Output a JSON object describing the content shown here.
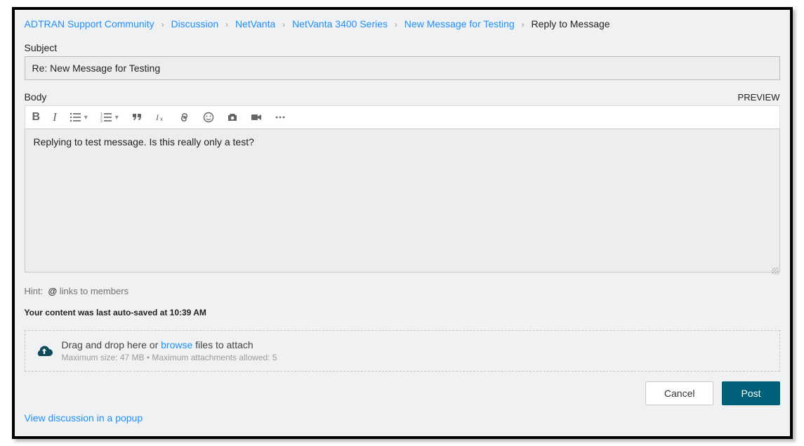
{
  "breadcrumb": {
    "items": [
      {
        "label": "ADTRAN Support Community"
      },
      {
        "label": "Discussion"
      },
      {
        "label": "NetVanta"
      },
      {
        "label": "NetVanta 3400 Series"
      },
      {
        "label": "New Message for Testing"
      }
    ],
    "current": "Reply to Message"
  },
  "subject": {
    "label": "Subject",
    "value": "Re: New Message for Testing"
  },
  "body": {
    "label": "Body",
    "preview_label": "PREVIEW",
    "content": "Replying to test message. Is this really only a test?"
  },
  "hint": {
    "prefix": "Hint:",
    "at": "@",
    "text": "links to members"
  },
  "autosave": {
    "text": "Your content was last auto-saved at 10:39 AM"
  },
  "dropzone": {
    "prefix": "Drag and drop here or ",
    "browse": "browse",
    "suffix": " files to attach",
    "meta": "Maximum size: 47 MB • Maximum attachments allowed: 5"
  },
  "actions": {
    "cancel": "Cancel",
    "post": "Post"
  },
  "popup_link": "View discussion in a popup"
}
